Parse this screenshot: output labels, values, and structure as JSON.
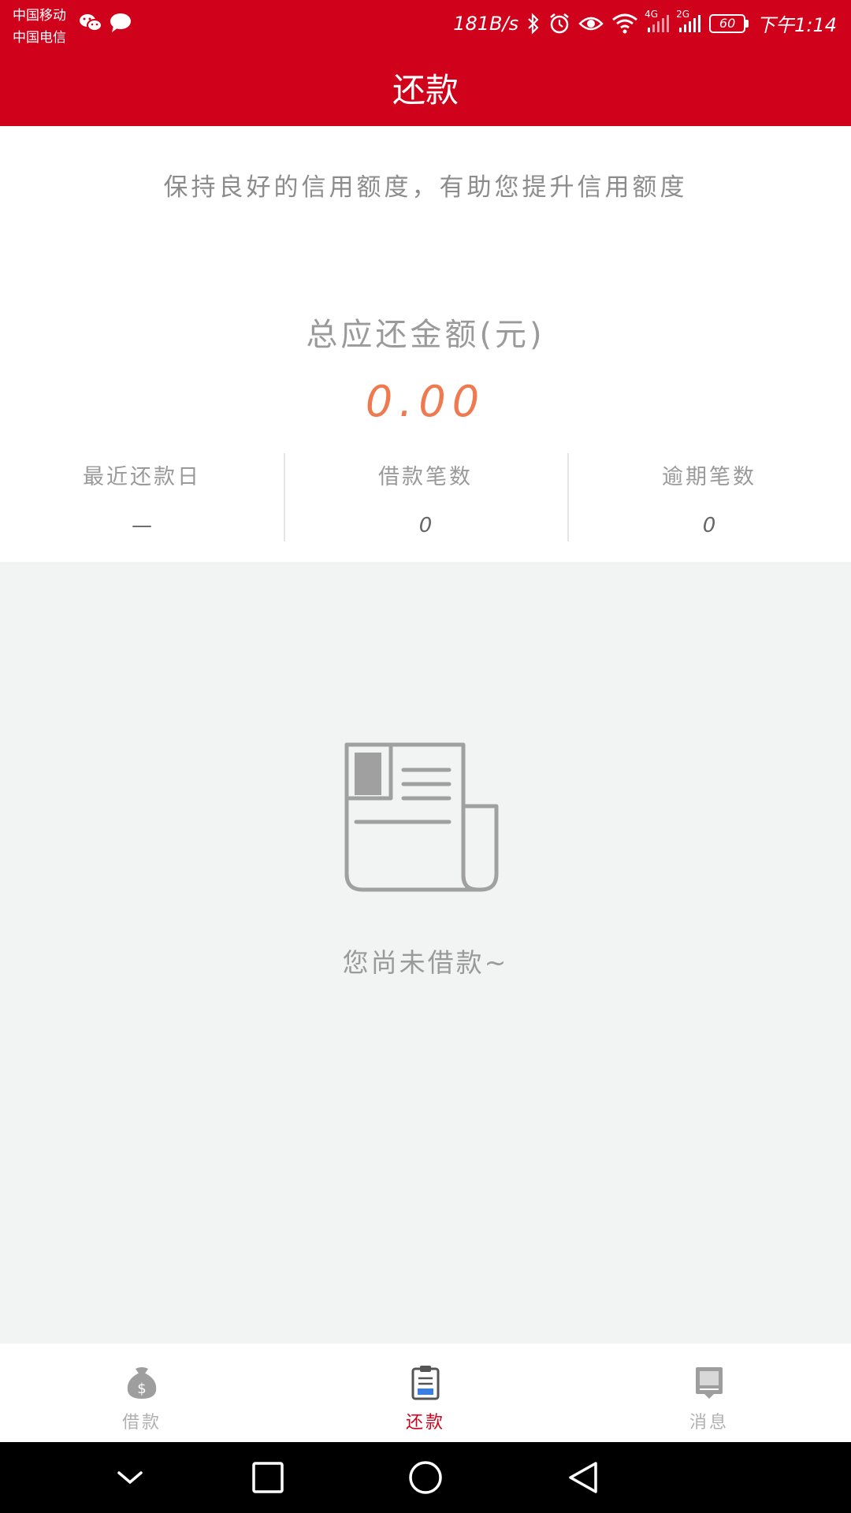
{
  "status_bar": {
    "carrier_1": "中国移动",
    "carrier_2": "中国电信",
    "net_speed": "181B/s",
    "network_1": "4G",
    "network_2": "2G",
    "battery": "60",
    "time": "下午1:14"
  },
  "header": {
    "title": "还款"
  },
  "main": {
    "tagline": "保持良好的信用额度，有助您提升信用额度",
    "total_label": "总应还金额(元)",
    "total_amount": "0.00",
    "stats": [
      {
        "label": "最近还款日",
        "value": "—"
      },
      {
        "label": "借款笔数",
        "value": "0"
      },
      {
        "label": "逾期笔数",
        "value": "0"
      }
    ],
    "empty_message": "您尚未借款~"
  },
  "tabs": [
    {
      "label": "借款",
      "icon": "money-bag-icon"
    },
    {
      "label": "还款",
      "icon": "clipboard-icon",
      "active": true
    },
    {
      "label": "消息",
      "icon": "message-icon"
    }
  ],
  "colors": {
    "brand_red": "#d0021b",
    "amount_orange": "#f07a50",
    "empty_bg": "#f2f3f3"
  }
}
